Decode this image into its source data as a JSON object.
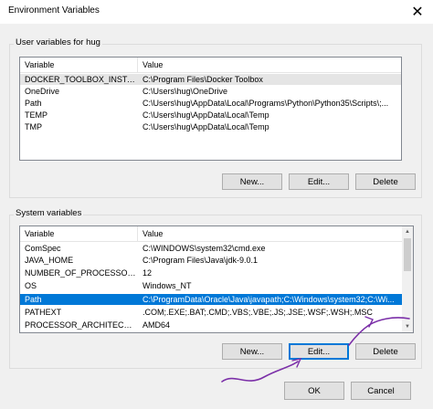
{
  "window": {
    "title": "Environment Variables",
    "close_glyph": "✕"
  },
  "user_group": {
    "label": "User variables for hug",
    "columns": [
      "Variable",
      "Value"
    ],
    "rows": [
      [
        "DOCKER_TOOLBOX_INSTAL...",
        "C:\\Program Files\\Docker Toolbox"
      ],
      [
        "OneDrive",
        "C:\\Users\\hug\\OneDrive"
      ],
      [
        "Path",
        "C:\\Users\\hug\\AppData\\Local\\Programs\\Python\\Python35\\Scripts\\;..."
      ],
      [
        "TEMP",
        "C:\\Users\\hug\\AppData\\Local\\Temp"
      ],
      [
        "TMP",
        "C:\\Users\\hug\\AppData\\Local\\Temp"
      ]
    ],
    "buttons": {
      "new": "New...",
      "edit": "Edit...",
      "delete": "Delete"
    }
  },
  "system_group": {
    "label": "System variables",
    "columns": [
      "Variable",
      "Value"
    ],
    "rows": [
      [
        "ComSpec",
        "C:\\WINDOWS\\system32\\cmd.exe"
      ],
      [
        "JAVA_HOME",
        "C:\\Program Files\\Java\\jdk-9.0.1"
      ],
      [
        "NUMBER_OF_PROCESSORS",
        "12"
      ],
      [
        "OS",
        "Windows_NT"
      ],
      [
        "Path",
        "C:\\ProgramData\\Oracle\\Java\\javapath;C:\\Windows\\system32;C:\\Wi..."
      ],
      [
        "PATHEXT",
        ".COM;.EXE;.BAT;.CMD;.VBS;.VBE;.JS;.JSE;.WSF;.WSH;.MSC"
      ],
      [
        "PROCESSOR_ARCHITECTURE",
        "AMD64"
      ]
    ],
    "selected_row": 4,
    "buttons": {
      "new": "New...",
      "edit": "Edit...",
      "delete": "Delete"
    }
  },
  "footer": {
    "ok": "OK",
    "cancel": "Cancel"
  },
  "colors": {
    "selection": "#0078d7",
    "annotation": "#7b2fa8"
  }
}
